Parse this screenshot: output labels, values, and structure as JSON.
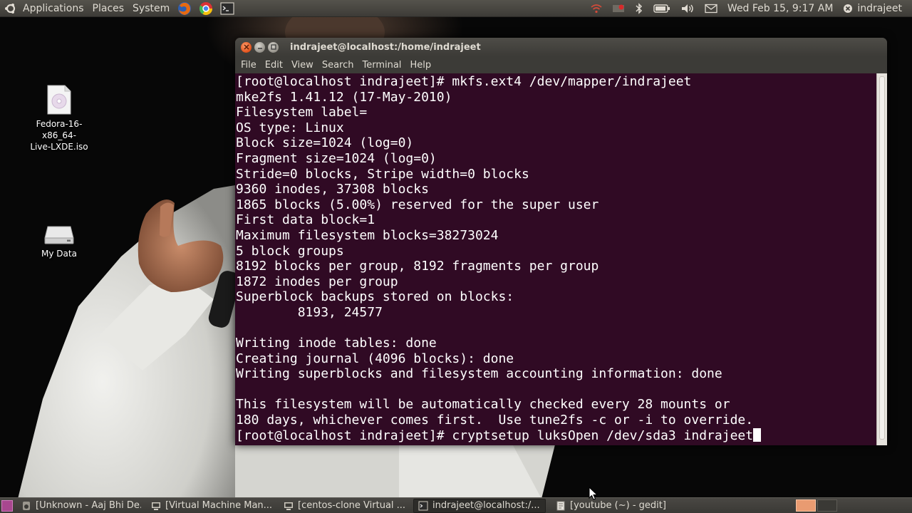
{
  "top_panel": {
    "menus": [
      "Applications",
      "Places",
      "System"
    ],
    "clock": "Wed Feb 15,  9:17 AM",
    "user": "indrajeet",
    "launchers": [
      "firefox-icon",
      "chrome-icon",
      "terminal-icon"
    ],
    "tray_icons": [
      "wifi-icon",
      "mail-indicator-icon",
      "bluetooth-icon",
      "battery-icon",
      "volume-icon",
      "message-icon"
    ]
  },
  "desktop": {
    "icons": [
      {
        "label": "Fedora-16-x86_64-Live-LXDE.iso",
        "label_lines": [
          "Fedora-16-x86_64-",
          "Live-LXDE.iso"
        ],
        "icon": "disc-image-icon"
      },
      {
        "label": "My Data",
        "icon": "drive-icon"
      }
    ]
  },
  "terminal": {
    "title": "indrajeet@localhost:/home/indrajeet",
    "menu": [
      "File",
      "Edit",
      "View",
      "Search",
      "Terminal",
      "Help"
    ],
    "background": "#300a24",
    "lines": [
      "[root@localhost indrajeet]# mkfs.ext4 /dev/mapper/indrajeet",
      "mke2fs 1.41.12 (17-May-2010)",
      "Filesystem label=",
      "OS type: Linux",
      "Block size=1024 (log=0)",
      "Fragment size=1024 (log=0)",
      "Stride=0 blocks, Stripe width=0 blocks",
      "9360 inodes, 37308 blocks",
      "1865 blocks (5.00%) reserved for the super user",
      "First data block=1",
      "Maximum filesystem blocks=38273024",
      "5 block groups",
      "8192 blocks per group, 8192 fragments per group",
      "1872 inodes per group",
      "Superblock backups stored on blocks:",
      "        8193, 24577",
      "",
      "Writing inode tables: done",
      "Creating journal (4096 blocks): done",
      "Writing superblocks and filesystem accounting information: done",
      "",
      "This filesystem will be automatically checked every 28 mounts or",
      "180 days, whichever comes first.  Use tune2fs -c or -i to override."
    ],
    "prompt_line": "[root@localhost indrajeet]# cryptsetup luksOpen /dev/sda3 indrajeet"
  },
  "taskbar": {
    "tasks": [
      {
        "label": "[Unknown - Aaj Bhi De...",
        "icon": "audio-player-icon",
        "active": false
      },
      {
        "label": "[Virtual Machine Man...",
        "icon": "vm-manager-icon",
        "active": false
      },
      {
        "label": "[centos-clone Virtual ...",
        "icon": "vm-console-icon",
        "active": false
      },
      {
        "label": "indrajeet@localhost:/...",
        "icon": "terminal-icon",
        "active": true
      },
      {
        "label": "[youtube (~) - gedit]",
        "icon": "text-editor-icon",
        "active": false
      }
    ],
    "accent": "#e99b71"
  }
}
